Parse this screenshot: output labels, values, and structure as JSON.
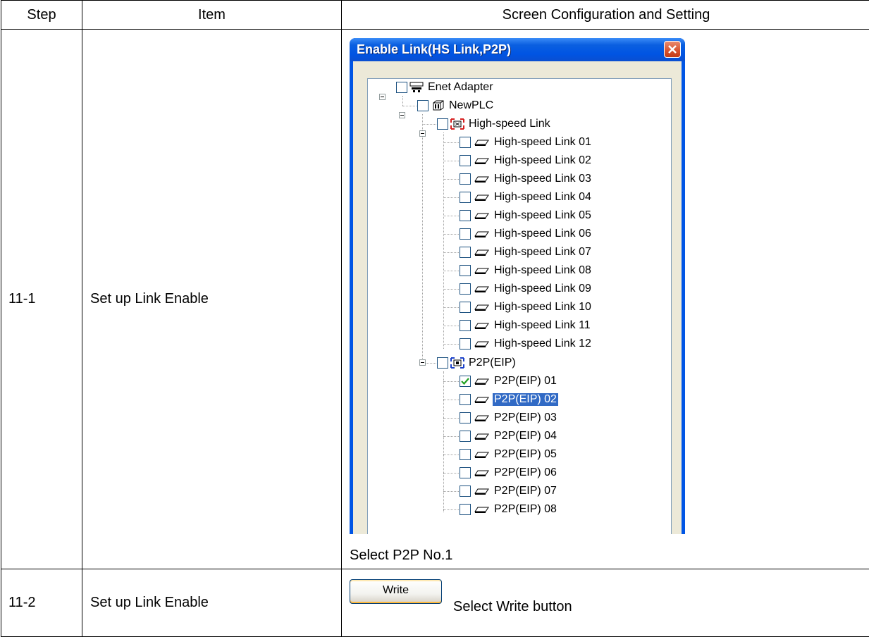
{
  "table": {
    "headers": [
      "Step",
      "Item",
      "Screen Configuration and Setting"
    ],
    "rows": [
      {
        "step": "11-1",
        "item": "Set up Link Enable",
        "caption": "Select P2P No.1"
      },
      {
        "step": "11-2",
        "item": "Set up Link Enable",
        "caption": "Select Write button"
      }
    ]
  },
  "dialog": {
    "title": "Enable Link(HS Link,P2P)",
    "tree": {
      "root": "Enet Adapter",
      "plc": "NewPLC",
      "hs_group": "High-speed Link",
      "hs_items": [
        "High-speed Link 01",
        "High-speed Link 02",
        "High-speed Link 03",
        "High-speed Link 04",
        "High-speed Link 05",
        "High-speed Link 06",
        "High-speed Link 07",
        "High-speed Link 08",
        "High-speed Link 09",
        "High-speed Link 10",
        "High-speed Link 11",
        "High-speed Link 12"
      ],
      "p2p_group": "P2P(EIP)",
      "p2p_items": [
        "P2P(EIP) 01",
        "P2P(EIP) 02",
        "P2P(EIP) 03",
        "P2P(EIP) 04",
        "P2P(EIP) 05",
        "P2P(EIP) 06",
        "P2P(EIP) 07",
        "P2P(EIP) 08"
      ],
      "p2p_checked_index": 0,
      "p2p_selected_index": 1
    }
  },
  "write_button": {
    "label": "Write"
  },
  "colors": {
    "titlebar": "#0054e3",
    "selection": "#316ac5",
    "check": "#21a121",
    "dialog_bg": "#ece9d8"
  }
}
